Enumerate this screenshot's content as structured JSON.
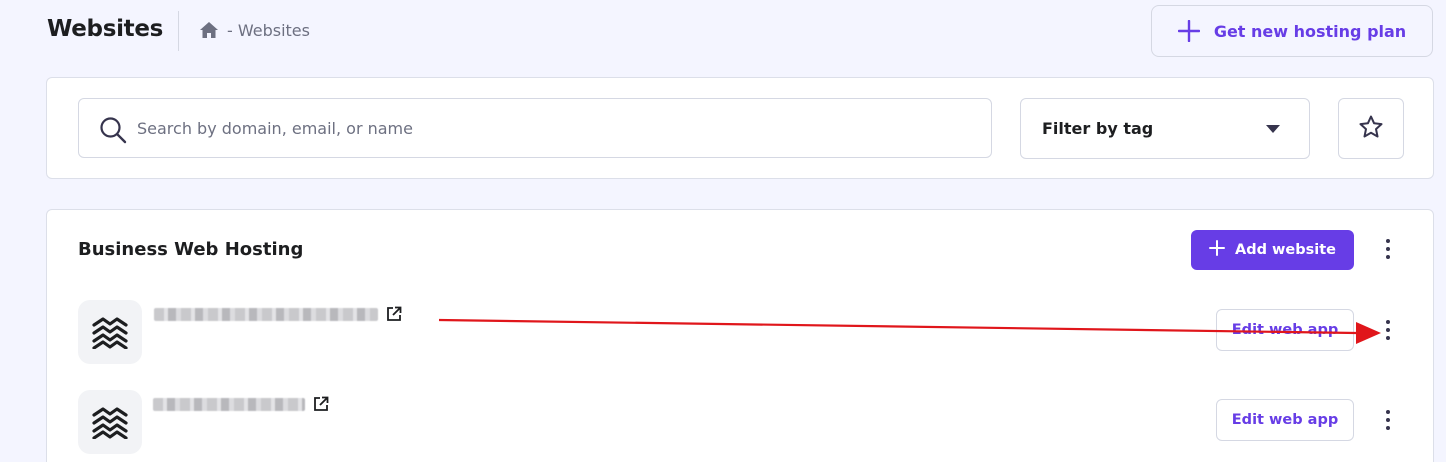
{
  "header": {
    "title": "Websites",
    "breadcrumb": "- Websites",
    "new_plan_label": "Get new hosting plan"
  },
  "filters": {
    "search_placeholder": "Search by domain, email, or name",
    "search_value": "",
    "tag_label": "Filter by tag"
  },
  "hosting": {
    "title": "Business Web Hosting",
    "add_label": "Add website",
    "sites": [
      {
        "domain": "",
        "action_label": "Edit web app"
      },
      {
        "domain": "",
        "action_label": "Edit web app"
      }
    ]
  },
  "icons": {
    "home": "home-icon",
    "plus": "plus-icon",
    "search": "search-icon",
    "caret": "caret-down-icon",
    "star": "star-icon",
    "more": "more-vertical-icon",
    "external": "external-link-icon",
    "site_logo": "layers-logo-icon"
  },
  "colors": {
    "accent": "#673de6",
    "background": "#f4f5ff",
    "annotation": "#e0161b"
  }
}
